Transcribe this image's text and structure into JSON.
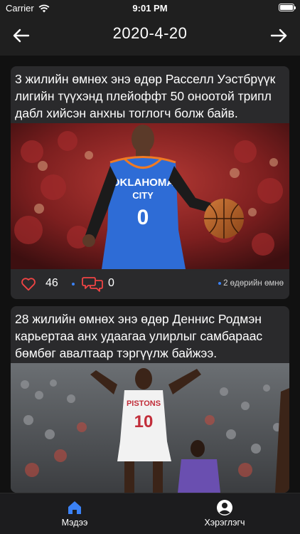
{
  "status_bar": {
    "carrier": "Carrier",
    "time": "9:01 PM"
  },
  "header": {
    "title": "2020-4-20",
    "back_icon": "arrow-left-icon",
    "next_icon": "arrow-right-icon"
  },
  "posts": [
    {
      "text": "3 жилийн өмнөх энэ өдөр Расселл Уэстбрүүк лигийн түүхэнд плейоффт 50 оноотой трипл дабл хийсэн анхны тоглогч болж байв.",
      "image_jersey_top": "OKLAHOMA",
      "image_jersey_mid": "CITY",
      "image_jersey_number": "0",
      "likes": "46",
      "comments": "0",
      "time_ago": "2 өдөрийн өмнө"
    },
    {
      "text": "28 жилийн өмнөх энэ өдөр Деннис Родмэн карьертаа анх удаагаа улирлыг самбараас бөмбөг авалтаар тэргүүлж байжээ.",
      "image_jersey_top": "PISTONS",
      "image_jersey_number": "10"
    }
  ],
  "tab_bar": {
    "items": [
      {
        "label": "Мэдээ",
        "icon": "home-icon",
        "active": true,
        "color": "#3b82f6"
      },
      {
        "label": "Хэрэглэгч",
        "icon": "user-icon",
        "active": false,
        "color": "#ffffff"
      }
    ]
  },
  "colors": {
    "background": "#111111",
    "bar": "#1f1f1f",
    "card": "#2a2a2c",
    "accent": "#3b82f6",
    "like": "#ef4444"
  }
}
